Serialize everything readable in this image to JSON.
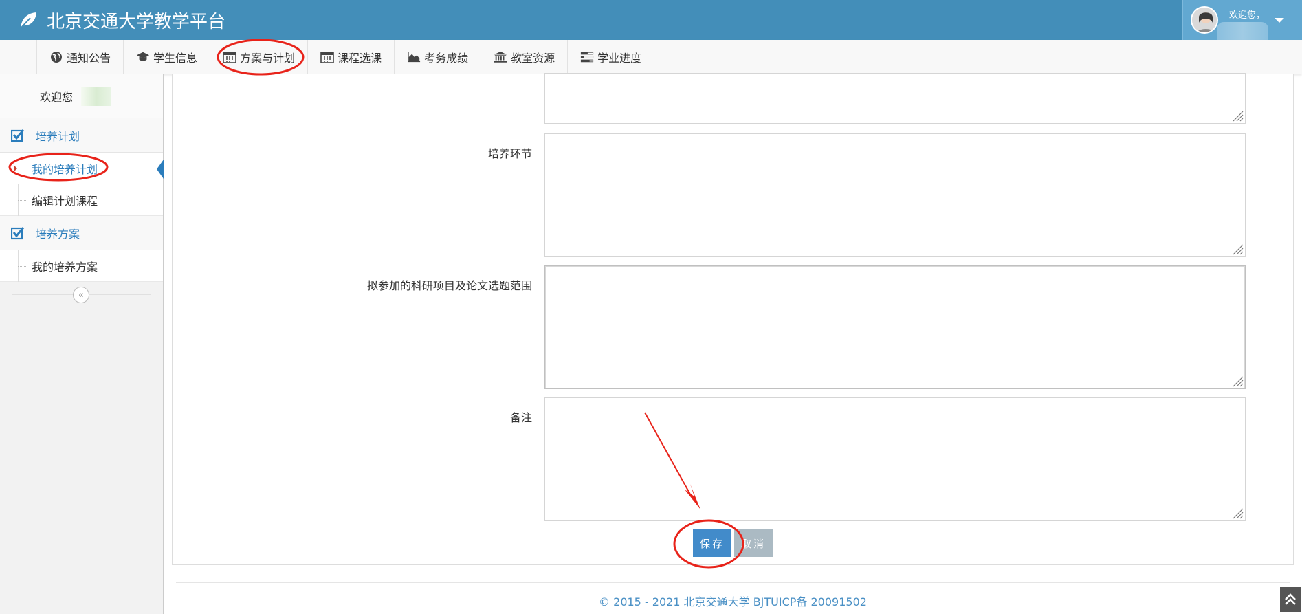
{
  "header": {
    "title": "北京交通大学教学平台",
    "user_greeting": "欢迎您，"
  },
  "nav": {
    "items": [
      {
        "label": "通知公告",
        "icon": "globe-icon"
      },
      {
        "label": "学生信息",
        "icon": "graduation-cap-icon"
      },
      {
        "label": "方案与计划",
        "icon": "calendar-icon"
      },
      {
        "label": "课程选课",
        "icon": "calendar-icon"
      },
      {
        "label": "考务成绩",
        "icon": "area-chart-icon"
      },
      {
        "label": "教室资源",
        "icon": "bank-icon"
      },
      {
        "label": "学业进度",
        "icon": "tasks-icon"
      }
    ]
  },
  "sidebar": {
    "welcome": "欢迎您",
    "groups": [
      {
        "label": "培养计划",
        "items": [
          {
            "label": "我的培养计划",
            "active": true
          },
          {
            "label": "编辑计划课程",
            "active": false
          }
        ]
      },
      {
        "label": "培养方案",
        "items": [
          {
            "label": "我的培养方案",
            "active": false
          }
        ]
      }
    ],
    "collapse_icon": "«"
  },
  "form": {
    "fields": [
      {
        "label": "培养环节"
      },
      {
        "label": "拟参加的科研项目及论文选题范围"
      },
      {
        "label": "备注"
      }
    ],
    "save_label": "保存",
    "cancel_label": "取消"
  },
  "footer": {
    "text": "© 2015 - 2021 北京交通大学 BJTUICP备 20091502"
  },
  "colors": {
    "header_bg": "#438eb9",
    "accent": "#2b7dbc",
    "save_button": "#428bca",
    "cancel_button": "#abbac3",
    "annotation_red": "#e8231a"
  }
}
